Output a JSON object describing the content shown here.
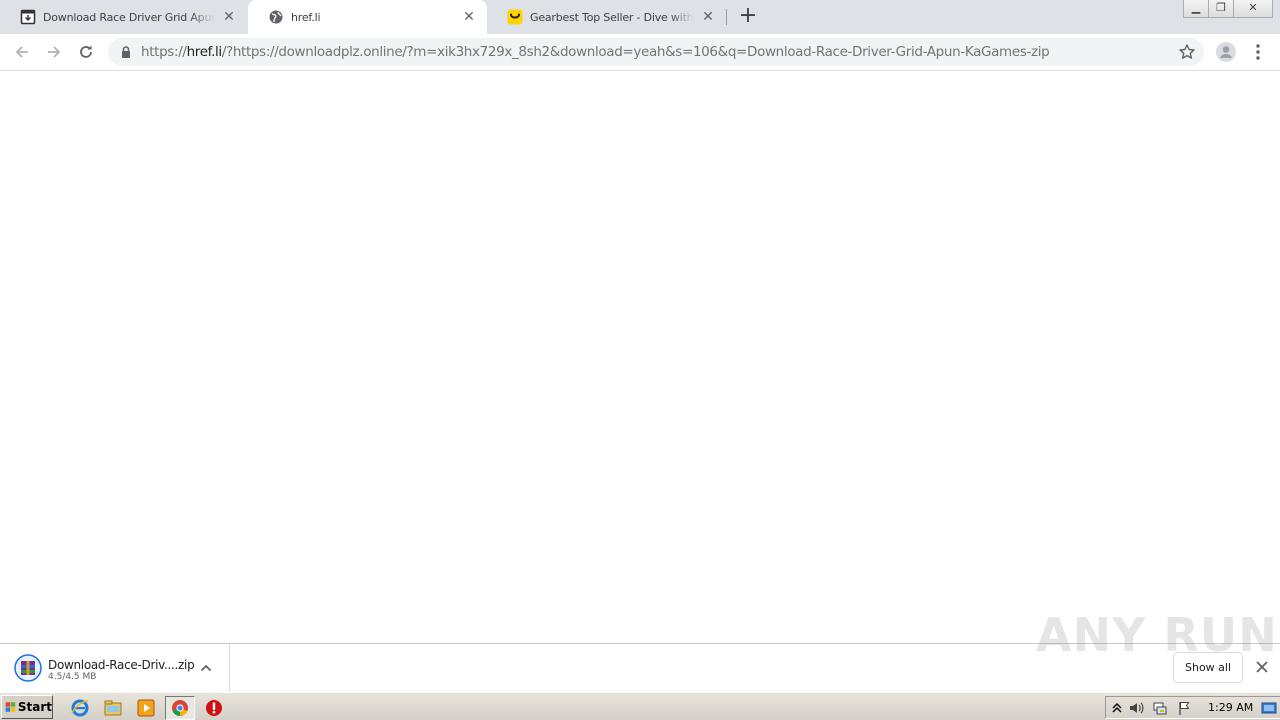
{
  "tabs": [
    {
      "title": "Download Race Driver Grid Apun KaGames",
      "favicon": "document-download-icon",
      "active": false
    },
    {
      "title": "href.li",
      "favicon": "globe-icon",
      "active": true
    },
    {
      "title": "Gearbest Top Seller - Dive with the Gearbest",
      "favicon": "gearbest-smile-icon",
      "active": false
    }
  ],
  "toolbar": {
    "url_scheme": "https://",
    "url_host": "href.li",
    "url_rest": "/?https://downloadplz.online/?m=xik3hx729x_8sh2&download=yeah&s=106&q=Download-Race-Driver-Grid-Apun-KaGames-zip"
  },
  "download": {
    "filename": "Download-Race-Driv....zip",
    "size": "4.5/4.5 MB",
    "show_all_label": "Show all"
  },
  "watermark": "ANY RUN",
  "taskbar": {
    "start_label": "Start",
    "clock": "1:29 AM"
  },
  "colors": {
    "tab_strip": "#dee1e6",
    "omnibox": "#f1f3f4",
    "taskbar": "#d4d0c8"
  }
}
